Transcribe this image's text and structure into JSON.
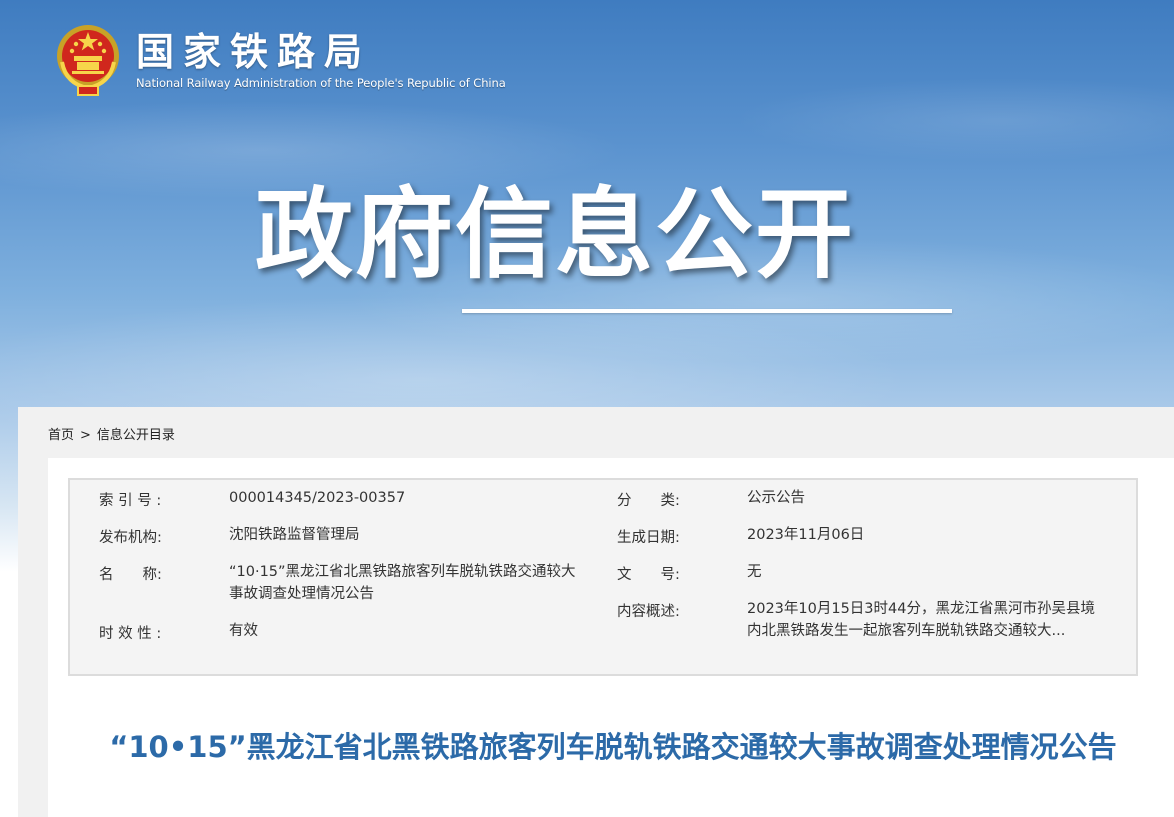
{
  "header": {
    "org_name_cn": "国家铁路局",
    "org_name_en": "National Railway Administration of the People's Republic of China",
    "emblem_icon": "national-emblem-icon"
  },
  "hero": {
    "title": "政府信息公开"
  },
  "breadcrumb": {
    "home": "首页",
    "separator": ">",
    "current": "信息公开目录"
  },
  "meta": {
    "index_label": "索 引 号 :",
    "index_value": "000014345/2023-00357",
    "category_label": "分　　类:",
    "category_value": "公示公告",
    "publisher_label": "发布机构:",
    "publisher_value": "沈阳铁路监督管理局",
    "date_label": "生成日期:",
    "date_value": "2023年11月06日",
    "name_label": "名　　称:",
    "name_value": "“10·15”黑龙江省北黑铁路旅客列车脱轨铁路交通较大事故调查处理情况公告",
    "docno_label": "文　　号:",
    "docno_value": "无",
    "summary_label": "内容概述:",
    "summary_value": "2023年10月15日3时44分，黑龙江省黑河市孙吴县境内北黑铁路发生一起旅客列车脱轨铁路交通较大...",
    "validity_label": "时 效 性 :",
    "validity_value": "有效"
  },
  "article": {
    "title": "“10•15”黑龙江省北黑铁路旅客列车脱轨铁路交通较大事故调查处理情况公告"
  },
  "colors": {
    "title_blue": "#2c6aa8",
    "sky_top": "#3f7cc0"
  }
}
